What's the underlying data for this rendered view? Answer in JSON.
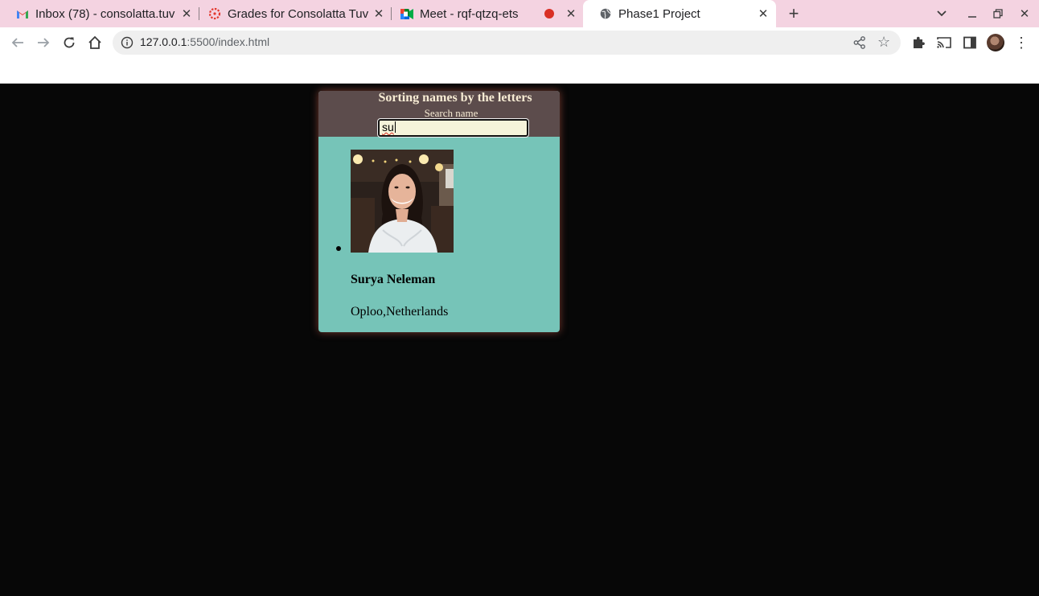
{
  "browser": {
    "tabs": [
      {
        "title": "Inbox (78) - consolatta.tuv",
        "favicon": "gmail-icon"
      },
      {
        "title": "Grades for Consolatta Tuv",
        "favicon": "canvas-icon"
      },
      {
        "title": "Meet - rqf-qtzq-ets",
        "favicon": "meet-icon",
        "recording": true
      },
      {
        "title": "Phase1 Project",
        "favicon": "globe-icon",
        "active": true
      }
    ],
    "url_host": "127.0.0.1",
    "url_rest": ":5500/index.html"
  },
  "page": {
    "title": "Sorting names by the letters",
    "search_label": "Search name",
    "search_value": "su",
    "results": [
      {
        "name": "Surya Neleman",
        "location": "Oploo,Netherlands"
      }
    ]
  },
  "colors": {
    "header_bg": "#5c4c4c",
    "card_bg": "#76c4b8",
    "page_bg": "#070707",
    "heading_text": "#f7ecd4",
    "input_bg": "#f5f3da"
  }
}
